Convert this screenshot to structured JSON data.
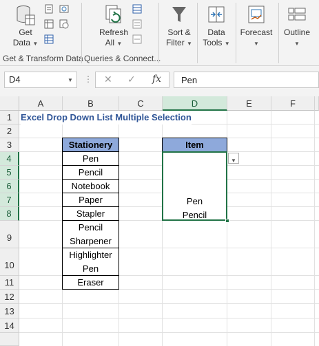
{
  "ribbon": {
    "get_data_label": "Get",
    "get_data_label2": "Data",
    "refresh_label": "Refresh",
    "refresh_label2": "All",
    "sort_label": "Sort &",
    "sort_label2": "Filter",
    "datatools_label": "Data",
    "datatools_label2": "Tools",
    "forecast_label": "Forecast",
    "outline_label": "Outline",
    "group1": "Get & Transform Data",
    "group2": "Queries & Connect..."
  },
  "formula_bar": {
    "name_box": "D4",
    "cancel": "✕",
    "enter": "✓",
    "fx": "fx",
    "value": "Pen"
  },
  "grid": {
    "columns": [
      "A",
      "B",
      "C",
      "D",
      "E",
      "F"
    ],
    "selected_column": "D",
    "rows": [
      "1",
      "2",
      "3",
      "4",
      "5",
      "6",
      "7",
      "8",
      "9",
      "10",
      "11",
      "12",
      "13",
      "14"
    ],
    "selected_rows": [
      "4",
      "5",
      "6",
      "7",
      "8"
    ]
  },
  "sheet": {
    "title": "Excel Drop Down List Multiple Selection",
    "stationery_header": "Stationery",
    "stationery": [
      "Pen",
      "Pencil",
      "Notebook",
      "Paper",
      "Stapler",
      "Pencil",
      "Sharpener",
      "Highlighter",
      "Pen",
      "Eraser"
    ],
    "item_header": "Item",
    "item_values": [
      "Pen",
      "Pencil"
    ]
  },
  "colors": {
    "accent_green": "#217346",
    "header_fill": "#8ea9db",
    "title_color": "#2f5597"
  }
}
